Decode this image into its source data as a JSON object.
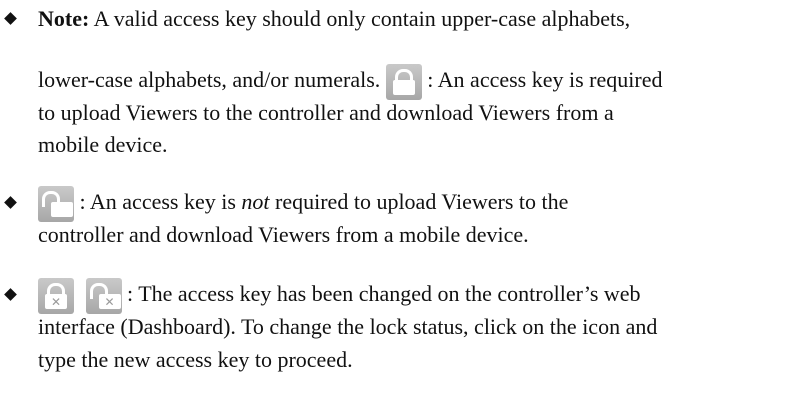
{
  "note_prefix": "Note:",
  "note_line1": " A valid access key should only contain upper-case alphabets,",
  "note_line2_before_icon": "lower-case alphabets, and/or numerals.",
  "note_line2_after_icon": ": An access key is required",
  "note_line3": "to upload Viewers to the controller and download Viewers from a",
  "note_line4": "mobile device.",
  "unlocked_line1_before": ": An access key is ",
  "unlocked_line1_italic": "not",
  "unlocked_line1_after": " required to upload Viewers to the",
  "unlocked_line2": "controller and download Viewers from a mobile device.",
  "changed_line1": ": The access key has been changed on the controller’s web",
  "changed_line2": "interface (Dashboard). To change the lock status, click on the icon and",
  "changed_line3": "type the new access key to proceed.",
  "icons": [
    "lock-closed-icon",
    "lock-open-icon",
    "lock-closed-changed-icon",
    "lock-open-changed-icon"
  ],
  "x_glyph": "✕",
  "colors": {
    "icon_bg": "#b4b4b4",
    "icon_fg": "#ffffff"
  }
}
